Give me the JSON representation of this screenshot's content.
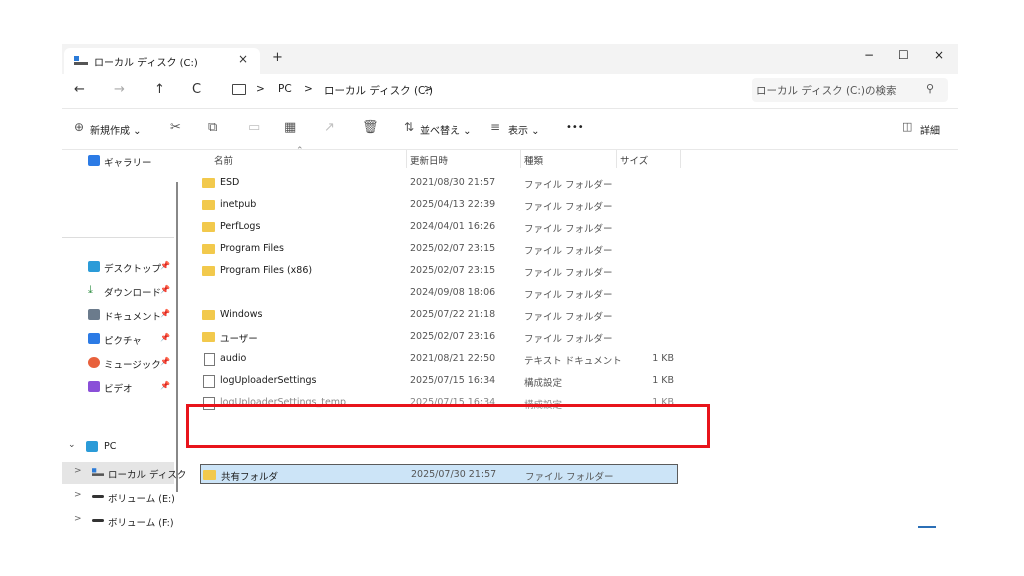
{
  "window": {
    "tab_title": "ローカル ディスク (C:)",
    "tab_close": "×",
    "new_tab": "+",
    "minimize": "−",
    "maximize": "☐",
    "close": "×"
  },
  "nav": {
    "back": "←",
    "forward": "→",
    "up": "↑",
    "refresh": "C",
    "breadcrumb": [
      "PC",
      "ローカル ディスク (C:)"
    ],
    "separator": ">",
    "search_placeholder": "ローカル ディスク (C:)の検索"
  },
  "toolbar": {
    "new_label": "新規作成",
    "sort_label": "並べ替え",
    "view_label": "表示",
    "more": "•••",
    "details_label": "詳細",
    "icons": [
      "cut-icon",
      "copy-icon",
      "paste-icon",
      "rename-icon",
      "share-icon",
      "delete-icon"
    ]
  },
  "sidebar": {
    "gallery": "ギャラリー",
    "quick": [
      {
        "label": "デスクトップ",
        "icon": "desktop-icon",
        "color": "#2b9bd8"
      },
      {
        "label": "ダウンロード",
        "icon": "download-icon",
        "color": "#2b8c3f"
      },
      {
        "label": "ドキュメント",
        "icon": "documents-icon",
        "color": "#6b7b8c"
      },
      {
        "label": "ピクチャ",
        "icon": "pictures-icon",
        "color": "#2c7be5"
      },
      {
        "label": "ミュージック",
        "icon": "music-icon",
        "color": "#e8613c"
      },
      {
        "label": "ビデオ",
        "icon": "videos-icon",
        "color": "#8a4fd8"
      }
    ],
    "pc": "PC",
    "drives": [
      "ローカル ディスク",
      "ボリューム (E:)",
      "ボリューム (F:)"
    ]
  },
  "columns": {
    "name": "名前",
    "date": "更新日時",
    "type": "種類",
    "size": "サイズ"
  },
  "files": [
    {
      "name": "ESD",
      "date": "2021/08/30 21:57",
      "type": "ファイル フォルダー",
      "size": "",
      "icon": "folder-icon"
    },
    {
      "name": "inetpub",
      "date": "2025/04/13 22:39",
      "type": "ファイル フォルダー",
      "size": "",
      "icon": "folder-icon"
    },
    {
      "name": "PerfLogs",
      "date": "2024/04/01 16:26",
      "type": "ファイル フォルダー",
      "size": "",
      "icon": "folder-icon"
    },
    {
      "name": "Program Files",
      "date": "2025/02/07 23:15",
      "type": "ファイル フォルダー",
      "size": "",
      "icon": "folder-icon"
    },
    {
      "name": "Program Files (x86)",
      "date": "2025/02/07 23:15",
      "type": "ファイル フォルダー",
      "size": "",
      "icon": "folder-icon"
    },
    {
      "name": "",
      "date": "2024/09/08 18:06",
      "type": "ファイル フォルダー",
      "size": "",
      "icon": "none"
    },
    {
      "name": "Windows",
      "date": "2025/07/22 21:18",
      "type": "ファイル フォルダー",
      "size": "",
      "icon": "folder-icon"
    },
    {
      "name": "ユーザー",
      "date": "2025/02/07 23:16",
      "type": "ファイル フォルダー",
      "size": "",
      "icon": "folder-icon"
    },
    {
      "name": "audio",
      "date": "2021/08/21 22:50",
      "type": "テキスト ドキュメント",
      "size": "1 KB",
      "icon": "text-file-icon"
    },
    {
      "name": "logUploaderSettings",
      "date": "2025/07/15 16:34",
      "type": "構成設定",
      "size": "1 KB",
      "icon": "config-file-icon"
    },
    {
      "name": "logUploaderSettings_temp",
      "date": "2025/07/15 16:34",
      "type": "構成設定",
      "size": "1 KB",
      "icon": "config-file-icon"
    },
    {
      "name": "共有フォルダ",
      "date": "2025/07/30 21:57",
      "type": "ファイル フォルダー",
      "size": "",
      "icon": "folder-icon"
    }
  ],
  "colors": {
    "selection": "#cce4f7",
    "highlight": "#e8141b",
    "folder": "#f2c94c"
  }
}
